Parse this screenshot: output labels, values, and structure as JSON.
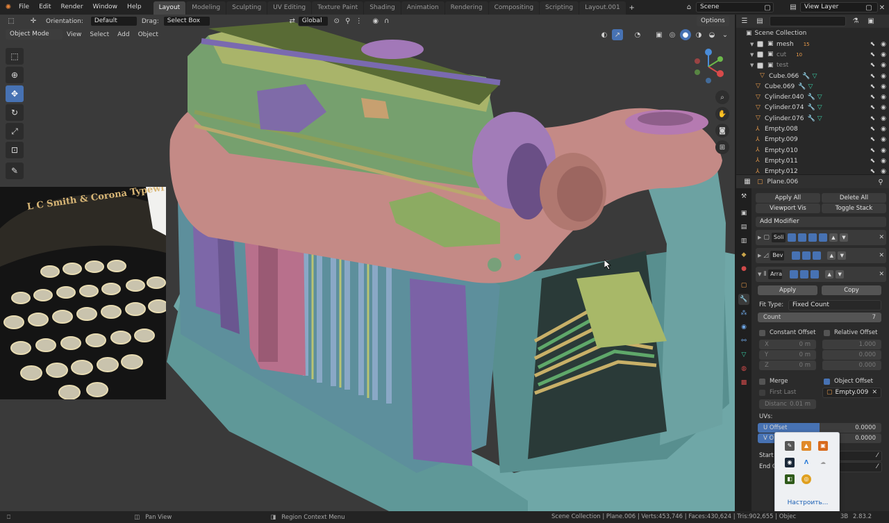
{
  "topbar": {
    "menus": [
      "File",
      "Edit",
      "Render",
      "Window",
      "Help"
    ],
    "workspaces": [
      "Layout",
      "Modeling",
      "Sculpting",
      "UV Editing",
      "Texture Paint",
      "Shading",
      "Animation",
      "Rendering",
      "Compositing",
      "Scripting",
      "Layout.001"
    ],
    "active_workspace": "Layout",
    "scene": "Scene",
    "view_layer": "View Layer"
  },
  "viewport": {
    "orientation_label": "Orientation:",
    "orientation_value": "Default",
    "drag_label": "Drag:",
    "drag_value": "Select Box",
    "transform_value": "Global",
    "options": "Options",
    "mode": "Object Mode",
    "menus": [
      "View",
      "Select",
      "Add",
      "Object"
    ],
    "photo_caption": "L C Smith & Corona Typewriter"
  },
  "outliner": {
    "root": "Scene Collection",
    "rows": [
      {
        "name": "mesh",
        "kind": "collection",
        "dim": false,
        "badge": "15"
      },
      {
        "name": "cut",
        "kind": "collection",
        "dim": true,
        "badge": "10"
      },
      {
        "name": "test",
        "kind": "collection",
        "dim": true,
        "badge": ""
      },
      {
        "name": "Cube.066",
        "kind": "object",
        "dim": false,
        "badge": ""
      },
      {
        "name": "Cube.069",
        "kind": "object",
        "dim": false,
        "badge": ""
      },
      {
        "name": "Cylinder.040",
        "kind": "object",
        "dim": false,
        "badge": ""
      },
      {
        "name": "Cylinder.074",
        "kind": "object",
        "dim": false,
        "badge": ""
      },
      {
        "name": "Cylinder.076",
        "kind": "object",
        "dim": false,
        "badge": ""
      },
      {
        "name": "Empty.008",
        "kind": "empty",
        "dim": false,
        "badge": ""
      },
      {
        "name": "Empty.009",
        "kind": "empty",
        "dim": false,
        "badge": ""
      },
      {
        "name": "Empty.010",
        "kind": "empty",
        "dim": false,
        "badge": ""
      },
      {
        "name": "Empty.011",
        "kind": "empty",
        "dim": false,
        "badge": ""
      },
      {
        "name": "Empty.012",
        "kind": "empty",
        "dim": false,
        "badge": ""
      }
    ]
  },
  "properties": {
    "object": "Plane.006",
    "apply_all": "Apply All",
    "delete_all": "Delete All",
    "viewport_vis": "Viewport Vis",
    "toggle_stack": "Toggle Stack",
    "add_modifier": "Add Modifier",
    "modifiers": [
      "Soli",
      "Bev",
      "Arra"
    ],
    "apply": "Apply",
    "copy": "Copy",
    "fit_type_label": "Fit Type:",
    "fit_type_value": "Fixed Count",
    "count_label": "Count",
    "count_value": "7",
    "constant_offset": "Constant Offset",
    "relative_offset": "Relative Offset",
    "axes": [
      "X",
      "Y",
      "Z"
    ],
    "constant_values": [
      "0 m",
      "0 m",
      "0 m"
    ],
    "relative_values": [
      "1.000",
      "0.000",
      "0.000"
    ],
    "merge": "Merge",
    "object_offset": "Object Offset",
    "first_last": "First Last",
    "object_offset_value": "Empty.009",
    "distance_label": "Distanc",
    "distance_value": "0.01 m",
    "uvs_label": "UVs:",
    "u_offset_label": "U Offset",
    "u_offset_value": "0.0000",
    "v_offset_label": "V O",
    "v_offset_value": "0.0000",
    "start_label": "Start",
    "end_label": "End C"
  },
  "statusbar": {
    "left1": "Pan View",
    "left2": "Region Context Menu",
    "stats": "Scene Collection | Plane.006 | Verts:453,746 | Faces:430,624 | Tris:902,655 | Objec",
    "memory": "3B",
    "version": "2.83.2"
  },
  "tray": {
    "customize": "Настроить..."
  }
}
